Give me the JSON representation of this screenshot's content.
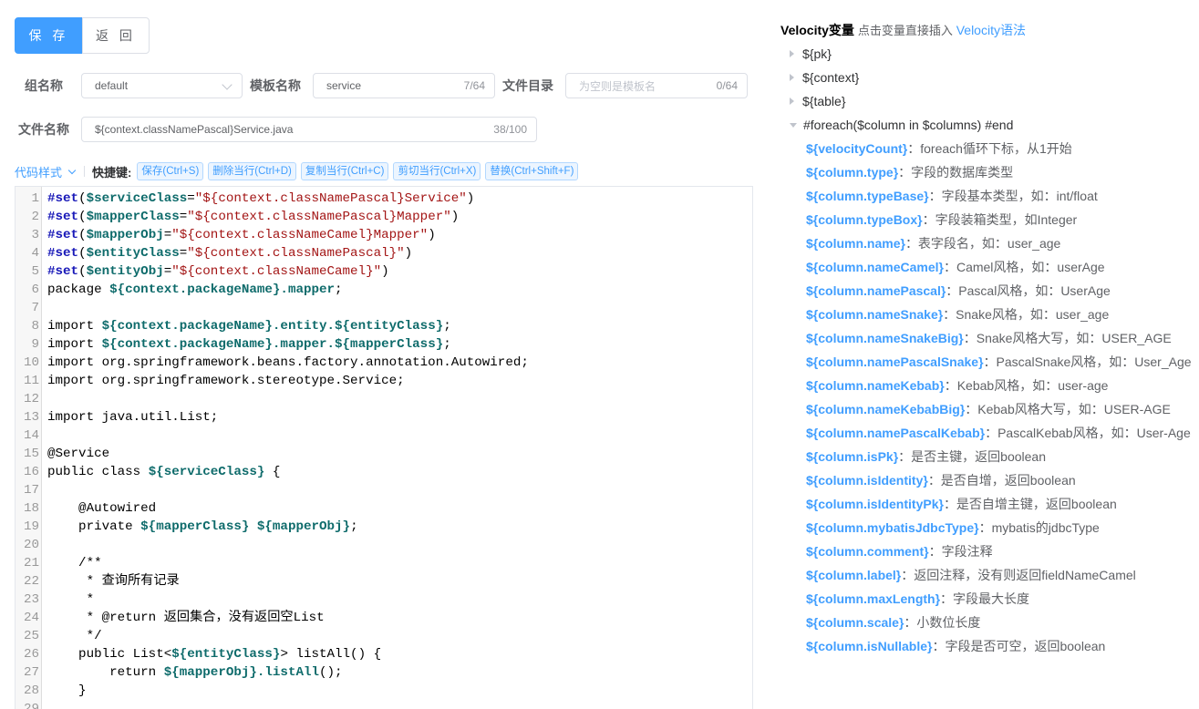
{
  "buttons": {
    "save": "保 存",
    "back": "返 回"
  },
  "form": {
    "group_label": "组名称",
    "group_value": "default",
    "template_label": "模板名称",
    "template_value": "service",
    "template_count": "7/64",
    "dir_label": "文件目录",
    "dir_placeholder": "为空则是模板名",
    "dir_count": "0/64",
    "file_label": "文件名称",
    "file_value": "${context.classNamePascal}Service.java",
    "file_count": "38/100"
  },
  "toolbar": {
    "style_label": "代码样式",
    "shortcut_label": "快捷键:",
    "shortcuts": [
      "保存(Ctrl+S)",
      "删除当行(Ctrl+D)",
      "复制当行(Ctrl+C)",
      "剪切当行(Ctrl+X)",
      "替换(Ctrl+Shift+F)"
    ]
  },
  "code_lines": [
    {
      "n": "1",
      "segs": [
        [
          "kw",
          "#set"
        ],
        [
          "",
          "("
        ],
        [
          "vr",
          "$serviceClass"
        ],
        [
          "",
          "="
        ],
        [
          "st",
          "\"${context.classNamePascal}Service\""
        ],
        [
          "",
          ")"
        ]
      ]
    },
    {
      "n": "2",
      "segs": [
        [
          "kw",
          "#set"
        ],
        [
          "",
          "("
        ],
        [
          "vr",
          "$mapperClass"
        ],
        [
          "",
          "="
        ],
        [
          "st",
          "\"${context.classNamePascal}Mapper\""
        ],
        [
          "",
          ")"
        ]
      ]
    },
    {
      "n": "3",
      "segs": [
        [
          "kw",
          "#set"
        ],
        [
          "",
          "("
        ],
        [
          "vr",
          "$mapperObj"
        ],
        [
          "",
          "="
        ],
        [
          "st",
          "\"${context.classNameCamel}Mapper\""
        ],
        [
          "",
          ")"
        ]
      ]
    },
    {
      "n": "4",
      "segs": [
        [
          "kw",
          "#set"
        ],
        [
          "",
          "("
        ],
        [
          "vr",
          "$entityClass"
        ],
        [
          "",
          "="
        ],
        [
          "st",
          "\"${context.classNamePascal}\""
        ],
        [
          "",
          ")"
        ]
      ]
    },
    {
      "n": "5",
      "segs": [
        [
          "kw",
          "#set"
        ],
        [
          "",
          "("
        ],
        [
          "vr",
          "$entityObj"
        ],
        [
          "",
          "="
        ],
        [
          "st",
          "\"${context.classNameCamel}\""
        ],
        [
          "",
          ")"
        ]
      ]
    },
    {
      "n": "6",
      "segs": [
        [
          "",
          "package "
        ],
        [
          "vr",
          "${context.packageName}.mapper"
        ],
        [
          "",
          ";"
        ]
      ]
    },
    {
      "n": "7",
      "segs": []
    },
    {
      "n": "8",
      "segs": [
        [
          "",
          "import "
        ],
        [
          "vr",
          "${context.packageName}.entity.${entityClass}"
        ],
        [
          "",
          ";"
        ]
      ]
    },
    {
      "n": "9",
      "segs": [
        [
          "",
          "import "
        ],
        [
          "vr",
          "${context.packageName}.mapper.${mapperClass}"
        ],
        [
          "",
          ";"
        ]
      ]
    },
    {
      "n": "10",
      "segs": [
        [
          "",
          "import org.springframework.beans.factory.annotation.Autowired;"
        ]
      ]
    },
    {
      "n": "11",
      "segs": [
        [
          "",
          "import org.springframework.stereotype.Service;"
        ]
      ]
    },
    {
      "n": "12",
      "segs": []
    },
    {
      "n": "13",
      "segs": [
        [
          "",
          "import java.util.List;"
        ]
      ]
    },
    {
      "n": "14",
      "segs": []
    },
    {
      "n": "15",
      "segs": [
        [
          "",
          "@Service"
        ]
      ]
    },
    {
      "n": "16",
      "segs": [
        [
          "",
          "public class "
        ],
        [
          "vr",
          "${serviceClass}"
        ],
        [
          "",
          " {"
        ]
      ]
    },
    {
      "n": "17",
      "segs": []
    },
    {
      "n": "18",
      "segs": [
        [
          "",
          "    @Autowired"
        ]
      ]
    },
    {
      "n": "19",
      "segs": [
        [
          "",
          "    private "
        ],
        [
          "vr",
          "${mapperClass}"
        ],
        [
          "",
          " "
        ],
        [
          "vr",
          "${mapperObj}"
        ],
        [
          "",
          ";"
        ]
      ]
    },
    {
      "n": "20",
      "segs": []
    },
    {
      "n": "21",
      "segs": [
        [
          "",
          "    /**"
        ]
      ]
    },
    {
      "n": "22",
      "segs": [
        [
          "",
          "     * 查询所有记录"
        ]
      ]
    },
    {
      "n": "23",
      "segs": [
        [
          "",
          "     *"
        ]
      ]
    },
    {
      "n": "24",
      "segs": [
        [
          "",
          "     * @return 返回集合，没有返回空List"
        ]
      ]
    },
    {
      "n": "25",
      "segs": [
        [
          "",
          "     */"
        ]
      ]
    },
    {
      "n": "26",
      "segs": [
        [
          "",
          "    public List<"
        ],
        [
          "vr",
          "${entityClass}"
        ],
        [
          "",
          "> listAll() {"
        ]
      ]
    },
    {
      "n": "27",
      "segs": [
        [
          "",
          "        return "
        ],
        [
          "vr",
          "${mapperObj}.listAll"
        ],
        [
          "",
          "();"
        ]
      ]
    },
    {
      "n": "28",
      "segs": [
        [
          "",
          "    }"
        ]
      ]
    },
    {
      "n": "29",
      "segs": []
    }
  ],
  "panel": {
    "title": "Velocity变量",
    "hint": "点击变量直接插入",
    "link": "Velocity语法",
    "tree": [
      "${pk}",
      "${context}",
      "${table}",
      "#foreach($column in $columns) #end"
    ],
    "vars": [
      [
        "${velocityCount}",
        "：foreach循环下标，从1开始"
      ],
      [
        "${column.type}",
        "：字段的数据库类型"
      ],
      [
        "${column.typeBase}",
        "：字段基本类型，如：int/float"
      ],
      [
        "${column.typeBox}",
        "：字段装箱类型，如Integer"
      ],
      [
        "${column.name}",
        "：表字段名，如：user_age"
      ],
      [
        "${column.nameCamel}",
        "：Camel风格，如：userAge"
      ],
      [
        "${column.namePascal}",
        "：Pascal风格，如：UserAge"
      ],
      [
        "${column.nameSnake}",
        "：Snake风格，如：user_age"
      ],
      [
        "${column.nameSnakeBig}",
        "：Snake风格大写，如：USER_AGE"
      ],
      [
        "${column.namePascalSnake}",
        "：PascalSnake风格，如：User_Age"
      ],
      [
        "${column.nameKebab}",
        "：Kebab风格，如：user-age"
      ],
      [
        "${column.nameKebabBig}",
        "：Kebab风格大写，如：USER-AGE"
      ],
      [
        "${column.namePascalKebab}",
        "：PascalKebab风格，如：User-Age"
      ],
      [
        "${column.isPk}",
        "：是否主键，返回boolean"
      ],
      [
        "${column.isIdentity}",
        "：是否自增，返回boolean"
      ],
      [
        "${column.isIdentityPk}",
        "：是否自增主键，返回boolean"
      ],
      [
        "${column.mybatisJdbcType}",
        "：mybatis的jdbcType"
      ],
      [
        "${column.comment}",
        "：字段注释"
      ],
      [
        "${column.label}",
        "：返回注释，没有则返回fieldNameCamel"
      ],
      [
        "${column.maxLength}",
        "：字段最大长度"
      ],
      [
        "${column.scale}",
        "：小数位长度"
      ],
      [
        "${column.isNullable}",
        "：字段是否可空，返回boolean"
      ]
    ]
  }
}
